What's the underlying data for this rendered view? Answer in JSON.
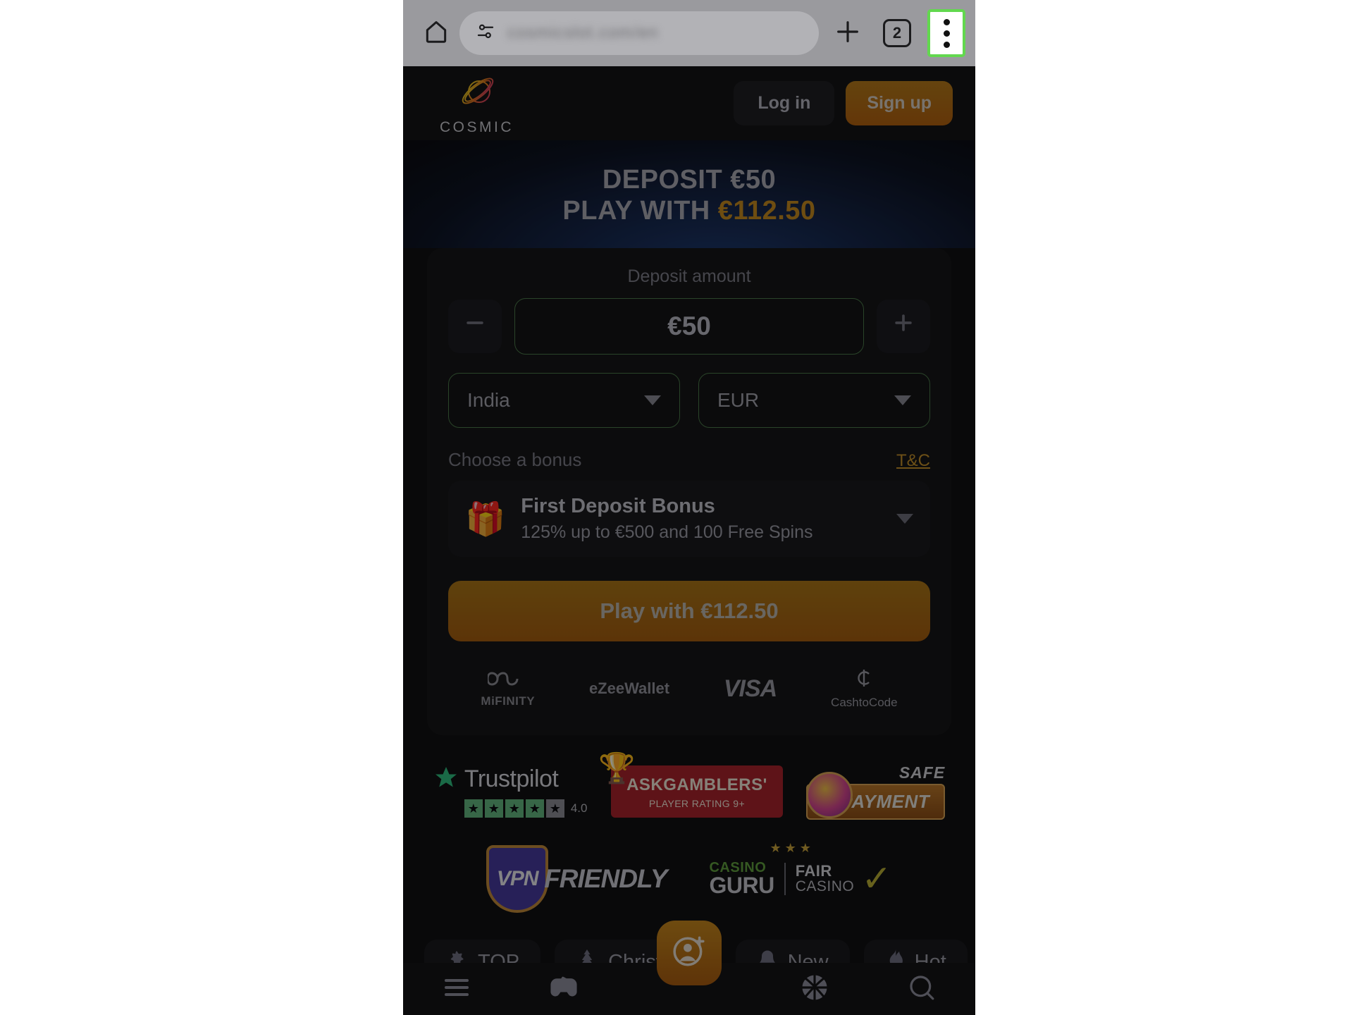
{
  "browser": {
    "home_icon": "home-icon",
    "site_info_icon": "tune-icon",
    "url_text": "cosmicslot.com/en",
    "new_tab_icon": "plus-icon",
    "tab_count": "2",
    "menu_icon": "three-dot-menu-icon",
    "highlight_color": "#62d84e"
  },
  "header": {
    "brand_name": "COSMIC",
    "logo_icon": "planet-logo-icon",
    "login_label": "Log in",
    "signup_label": "Sign up",
    "signup_color": "#b1610f"
  },
  "hero": {
    "line1": "DEPOSIT €50",
    "line2_prefix": "PLAY WITH ",
    "line2_amount": "€112.50",
    "amount_color": "#c58a1f"
  },
  "deposit": {
    "label": "Deposit amount",
    "decrease_icon": "minus-icon",
    "increase_icon": "plus-icon",
    "amount_value": "€50",
    "field_border_color": "#4c7a4a",
    "country": "India",
    "currency": "EUR",
    "dropdown_icon": "chevron-down-icon"
  },
  "bonus": {
    "section_label": "Choose a bonus",
    "tc_label": "T&C",
    "tc_color": "#c38f2a",
    "gift_icon": "gift-box-icon",
    "title": "First Deposit Bonus",
    "subtitle": "125% up to €500 and 100 Free Spins",
    "expand_icon": "chevron-down-icon"
  },
  "cta": {
    "label": "Play with €112.50"
  },
  "payments": [
    {
      "name": "MiFINITY",
      "icon": "infinity-icon"
    },
    {
      "name": "eZeeWallet",
      "icon": "ezeewallet-icon"
    },
    {
      "name": "VISA",
      "icon": "visa-icon"
    },
    {
      "name": "CashtoCode",
      "icon": "cashtocode-icon"
    }
  ],
  "trust": {
    "trustpilot": {
      "name": "Trustpilot",
      "star_icon": "star-icon",
      "score": "4.0",
      "stars_filled": 4,
      "stars_total": 5,
      "star_color": "#63b77f"
    },
    "askgamblers": {
      "title": "ASKGAMBLERS'",
      "subtitle": "PLAYER RATING 9+",
      "trophy_icon": "trophy-icon",
      "ribbon_color": "#a8232c"
    },
    "safe_payment": {
      "line1": "SAFE",
      "line2": "PAYMENT",
      "gem_icon": "gem-icon"
    },
    "vpn_friendly": {
      "shield_text": "VPN",
      "word": "FRIENDLY",
      "shield_icon": "shield-icon"
    },
    "casino_guru": {
      "brand_top": "CASINO",
      "brand_bottom": "GURU",
      "fair_top": "FAIR",
      "fair_bottom": "CASINO",
      "stars": "★★★",
      "check_icon": "check-icon"
    }
  },
  "chips": [
    {
      "label": "TOP",
      "icon": "star-icon"
    },
    {
      "label": "Christmas",
      "icon": "christmas-tree-icon"
    },
    {
      "label": "New",
      "icon": "bell-icon"
    },
    {
      "label": "Hot",
      "icon": "flame-icon"
    }
  ],
  "bottom_nav": {
    "items": [
      {
        "icon": "hamburger-menu-icon"
      },
      {
        "icon": "game-controller-icon"
      },
      {
        "icon": "basketball-icon"
      },
      {
        "icon": "search-icon"
      }
    ],
    "fab_icon": "account-add-icon",
    "fab_color": "#a85c10"
  }
}
